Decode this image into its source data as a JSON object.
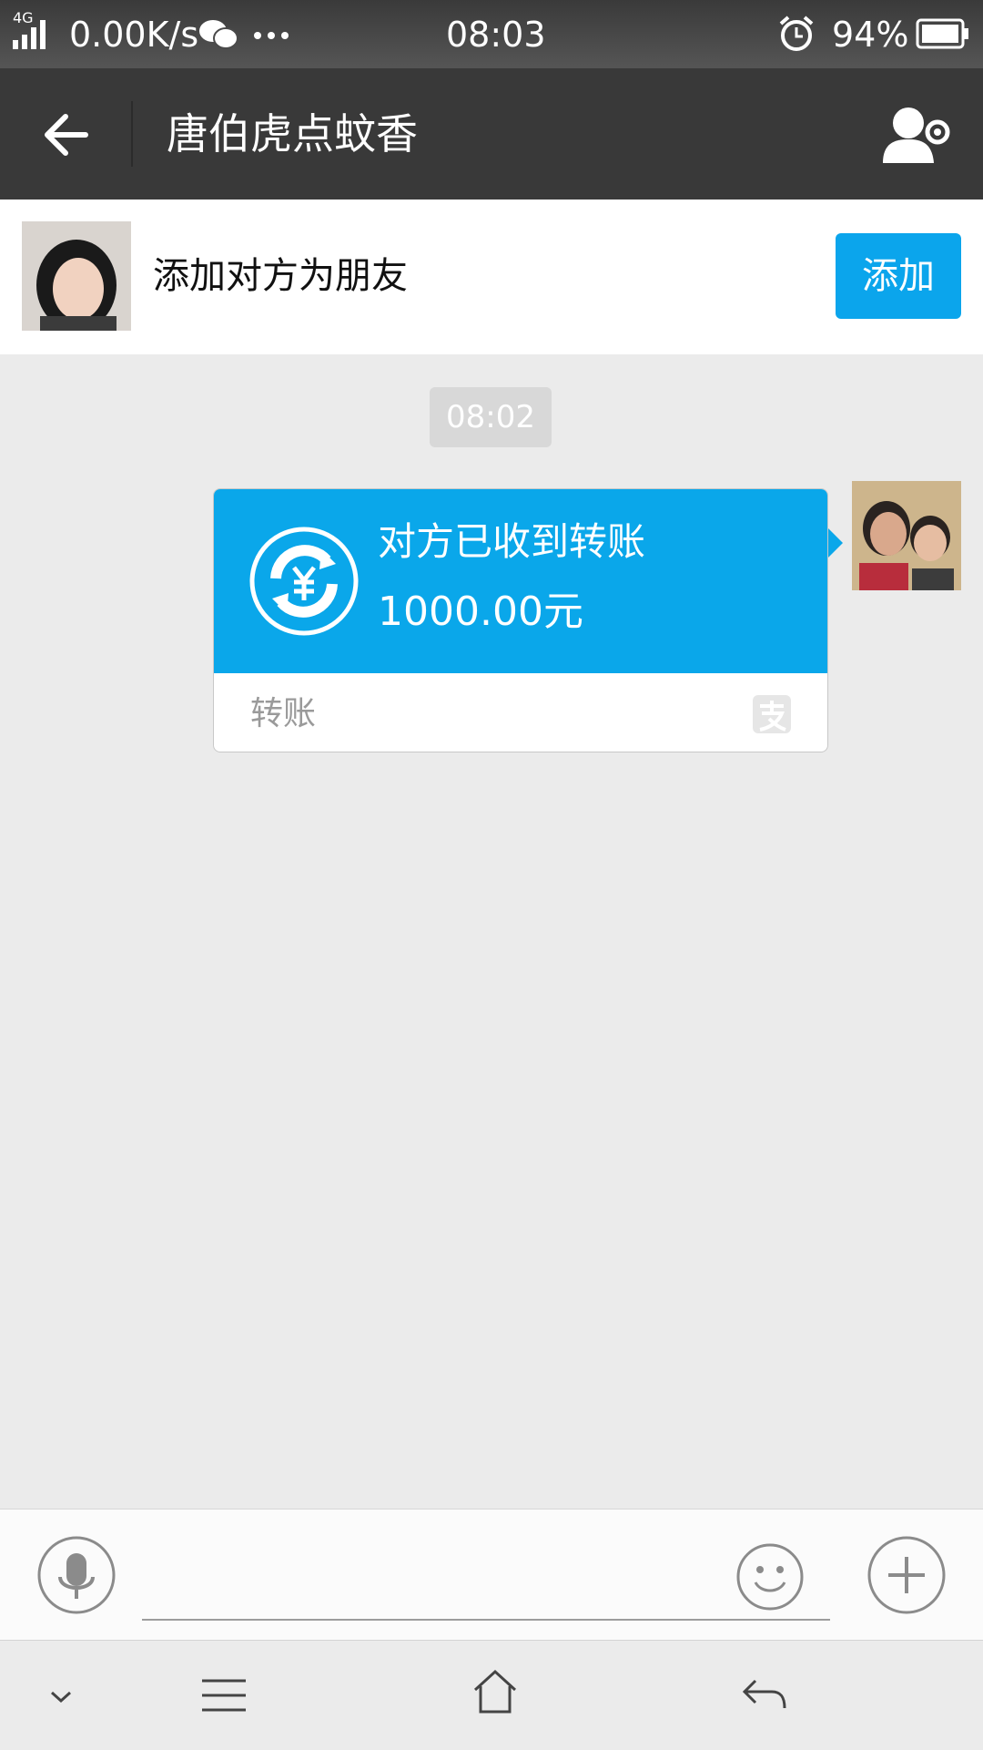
{
  "status_bar": {
    "network": "4G",
    "speed": "0.00K/s",
    "time": "08:03",
    "battery": "94%",
    "icons": [
      "signal-icon",
      "wechat-icon",
      "more-dots-icon",
      "alarm-icon",
      "battery-icon"
    ]
  },
  "header": {
    "title": "唐伯虎点蚊香",
    "back_icon": "arrow-left-icon",
    "settings_icon": "contact-settings-icon"
  },
  "add_friend": {
    "label": "添加对方为朋友",
    "button": "添加"
  },
  "messages": {
    "timestamp": "08:02",
    "transfer": {
      "status": "对方已收到转账",
      "amount": "1000.00元",
      "footer": "转账",
      "accent": "#0aa7ea"
    }
  },
  "input_bar": {
    "voice_icon": "microphone-icon",
    "emoji_icon": "smiley-icon",
    "plus_icon": "plus-icon"
  },
  "nav_bar": {
    "icons": [
      "chevron-down-icon",
      "menu-icon",
      "home-icon",
      "back-icon"
    ]
  },
  "colors": {
    "header_bg": "#393939",
    "accent_blue": "#0ba5ec",
    "chat_bg": "#ebebeb"
  }
}
